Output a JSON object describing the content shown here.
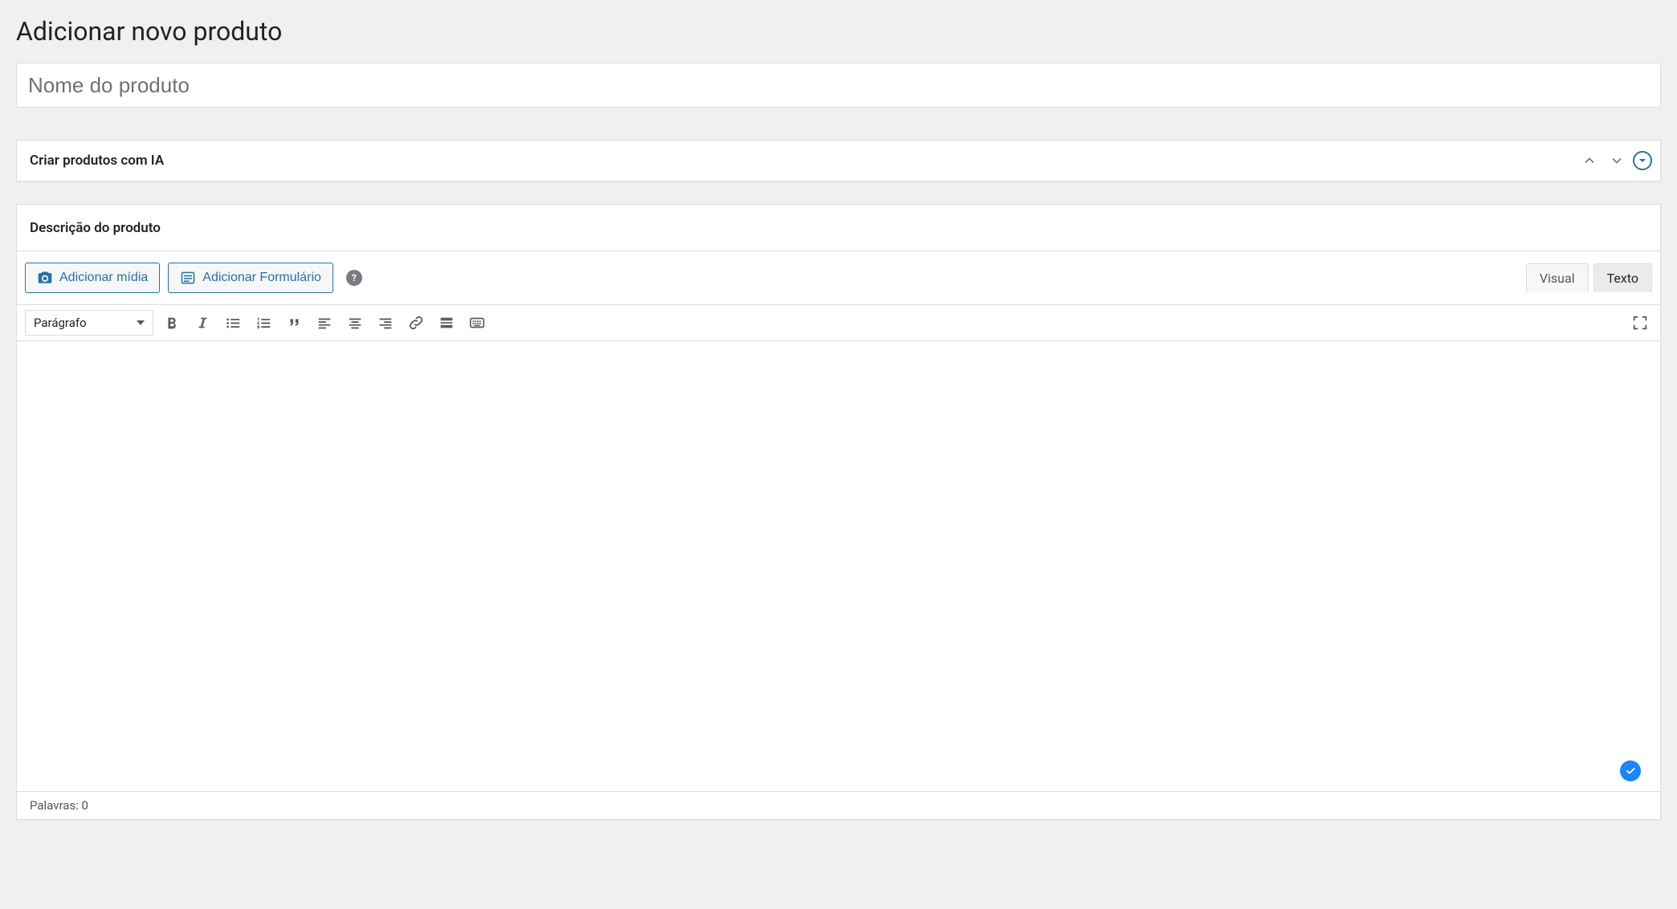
{
  "page": {
    "title": "Adicionar novo produto"
  },
  "product": {
    "name_placeholder": "Nome do produto",
    "name_value": ""
  },
  "ai_box": {
    "title": "Criar produtos com IA"
  },
  "description_box": {
    "title": "Descrição do produto",
    "add_media": "Adicionar mídia",
    "add_form": "Adicionar Formulário",
    "tab_visual": "Visual",
    "tab_texto": "Texto",
    "format_select": "Parágrafo",
    "word_count_label": "Palavras: 0"
  },
  "icons": {
    "help": "?"
  }
}
